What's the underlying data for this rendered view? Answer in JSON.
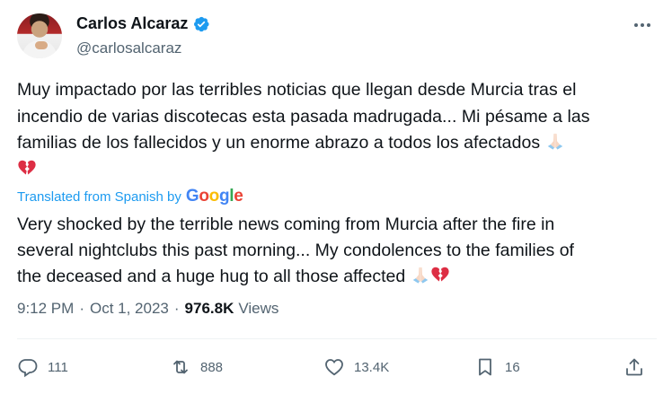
{
  "author": {
    "name": "Carlos Alcaraz",
    "handle": "@carlosalcaraz"
  },
  "tweet": {
    "text_line1": "Muy impactado por las terribles noticias que llegan desde Murcia tras el",
    "text_line2": "incendio de varias discotecas esta pasada madrugada... Mi pésame a las",
    "text_line3": "familias de los fallecidos y un enorme abrazo a todos los afectados",
    "translated_label": "Translated from Spanish by",
    "translator_brand": "Google",
    "translation_line1": "Very shocked by the terrible news coming from Murcia after the fire in",
    "translation_line2": "several nightclubs this past morning... My condolences to the families of",
    "translation_line3": "the deceased and a huge hug to all those affected"
  },
  "meta": {
    "time": "9:12 PM",
    "date": "Oct 1, 2023",
    "views_count": "976.8K",
    "views_label": "Views"
  },
  "actions": {
    "replies": "111",
    "retweets": "888",
    "likes": "13.4K",
    "bookmarks": "16"
  },
  "colors": {
    "accent": "#1d9bf0",
    "secondary_text": "#536471",
    "primary_text": "#0f1419"
  }
}
